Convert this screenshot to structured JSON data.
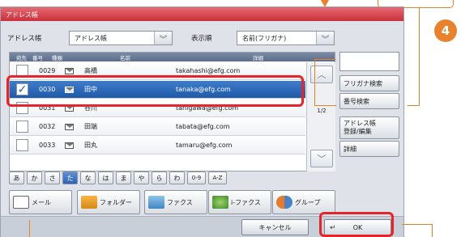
{
  "step_number": "4",
  "window": {
    "title": "アドレス帳"
  },
  "header": {
    "book_label": "アドレス帳",
    "book_value": "アドレス帳",
    "sort_label": "表示順",
    "sort_value": "名前(フリガナ)"
  },
  "columns": [
    "宛先",
    "番号",
    "種類",
    "名前",
    "詳細"
  ],
  "rows": [
    {
      "number": "0029",
      "name": "高橋",
      "email": "takahashi@efg.com",
      "selected": false
    },
    {
      "number": "0030",
      "name": "田中",
      "email": "tanaka@efg.com",
      "selected": true
    },
    {
      "number": "0031",
      "name": "谷川",
      "email": "tanigawa@efg.com",
      "selected": false
    },
    {
      "number": "0032",
      "name": "田端",
      "email": "tabata@efg.com",
      "selected": false
    },
    {
      "number": "0033",
      "name": "田丸",
      "email": "tamaru@efg.com",
      "selected": false
    }
  ],
  "pagination": "1/2",
  "side_buttons": {
    "furigana_search": "フリガナ検索",
    "number_search": "番号検索",
    "register_edit_line1": "アドレス帳",
    "register_edit_line2": "登録/編集",
    "details": "詳細"
  },
  "kana_tabs": [
    "あ",
    "か",
    "さ",
    "た",
    "な",
    "は",
    "ま",
    "や",
    "ら",
    "わ",
    "0-9",
    "A-Z"
  ],
  "active_kana": "た",
  "type_buttons": {
    "mail": "メール",
    "folder": "フォルダー",
    "fax": "ファクス",
    "ifax": "i-ファクス",
    "group": "グループ"
  },
  "footer": {
    "cancel": "キャンセル",
    "ok": "OK"
  },
  "colors": {
    "accent": "#e4252b",
    "callout": "#e8812a",
    "titlebar": "#d63c47",
    "selection": "#2c62b1"
  }
}
